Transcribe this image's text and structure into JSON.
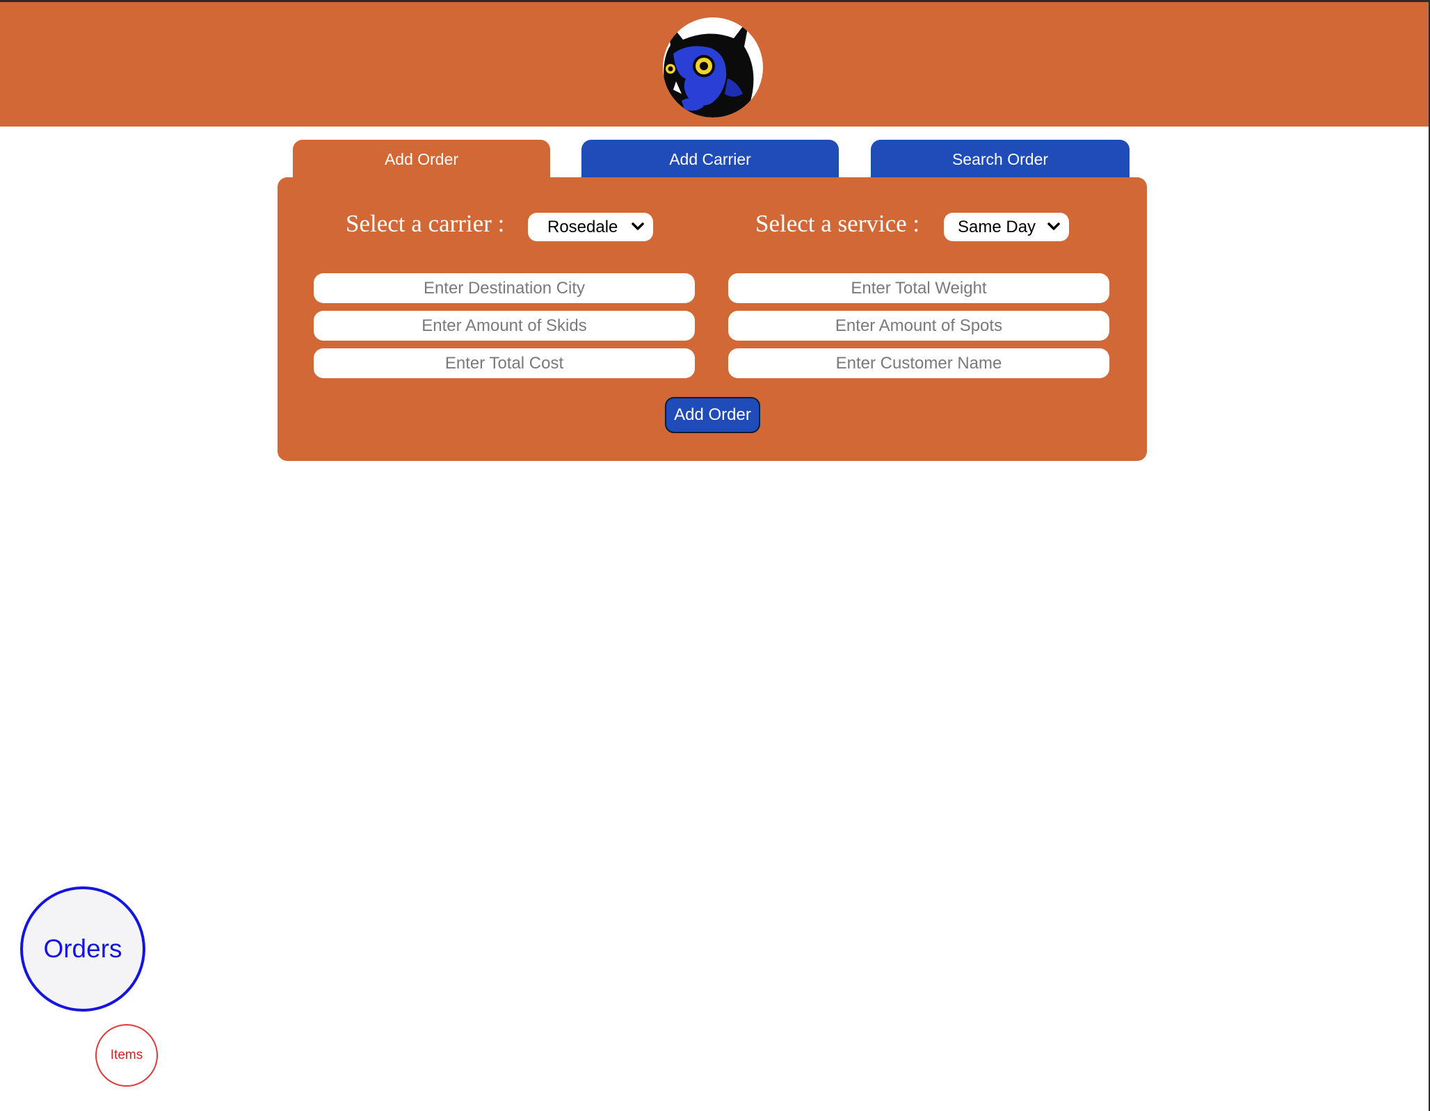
{
  "header": {
    "logo_icon": "owl-logo-icon",
    "brand_color": "#d16836"
  },
  "tabs": [
    {
      "label": "Add Order",
      "active": true
    },
    {
      "label": "Add Carrier",
      "active": false
    },
    {
      "label": "Search Order",
      "active": false
    }
  ],
  "form": {
    "carrier_label": "Select a carrier :",
    "carrier_selected": "Rosedale",
    "service_label": "Select a service :",
    "service_selected": "Same Day",
    "fields": {
      "destination_city": "Enter Destination City",
      "total_weight": "Enter Total Weight",
      "amount_skids": "Enter Amount of Skids",
      "amount_spots": "Enter Amount of Spots",
      "total_cost": "Enter Total Cost",
      "customer_name": "Enter Customer Name"
    },
    "submit_label": "Add Order"
  },
  "nav_bubbles": {
    "orders_label": "Orders",
    "items_label": "Items"
  },
  "colors": {
    "accent_orange": "#d16836",
    "accent_blue": "#1f4cb8",
    "orders_blue": "#1515e0",
    "items_red": "#d42020"
  }
}
